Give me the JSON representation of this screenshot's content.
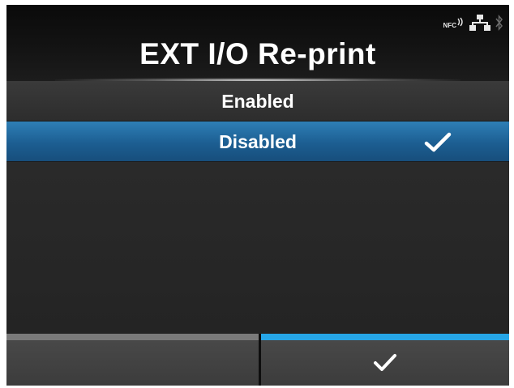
{
  "header": {
    "title": "EXT I/O Re-print",
    "status": {
      "nfc_label": "NFC",
      "icons": [
        "nfc-icon",
        "lan-icon",
        "bluetooth-icon"
      ]
    }
  },
  "options": [
    {
      "label": "Enabled",
      "selected": false
    },
    {
      "label": "Disabled",
      "selected": true
    }
  ],
  "footer": {
    "left_button": {
      "icon": "none"
    },
    "right_button": {
      "icon": "check-icon",
      "accent": "#26a6e8"
    }
  },
  "colors": {
    "selection": "#1c5e92",
    "accent": "#26a6e8",
    "background": "#2a2a2a"
  }
}
